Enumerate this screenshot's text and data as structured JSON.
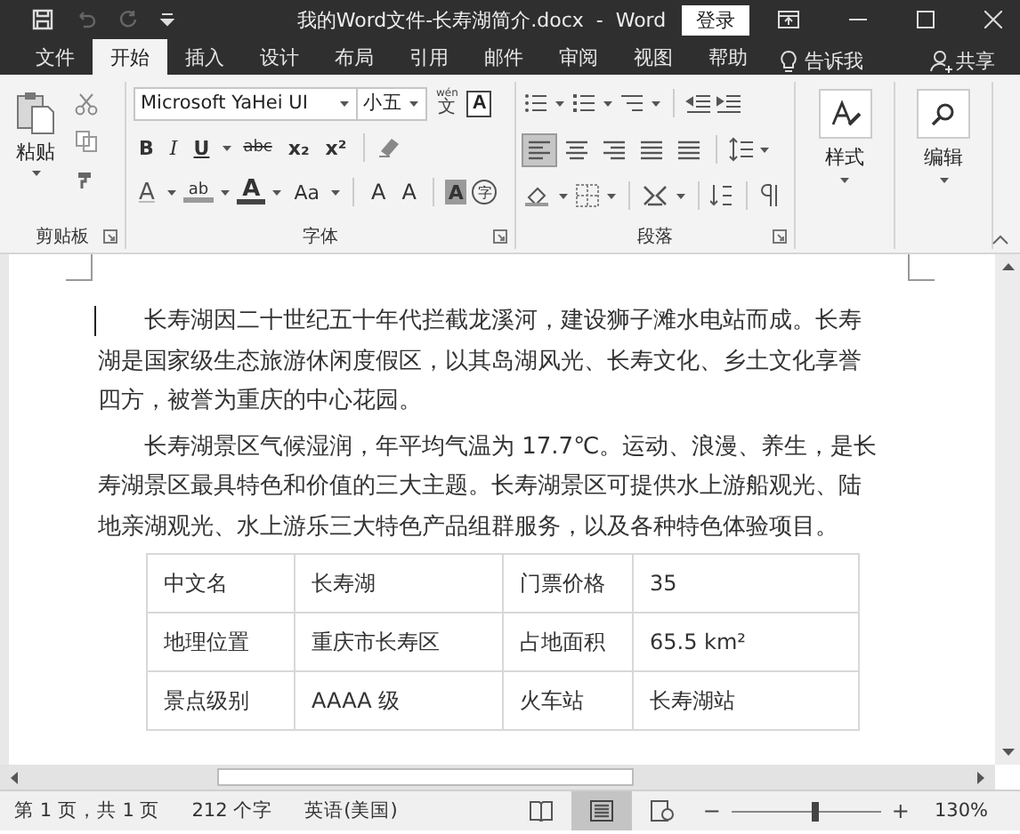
{
  "window": {
    "title": "我的Word文件-长寿湖简介.docx  -  Word",
    "sign_in": "登录"
  },
  "tabs": [
    {
      "label": "文件",
      "selected": false
    },
    {
      "label": "开始",
      "selected": true
    },
    {
      "label": "插入",
      "selected": false
    },
    {
      "label": "设计",
      "selected": false
    },
    {
      "label": "布局",
      "selected": false
    },
    {
      "label": "引用",
      "selected": false
    },
    {
      "label": "邮件",
      "selected": false
    },
    {
      "label": "审阅",
      "selected": false
    },
    {
      "label": "视图",
      "selected": false
    },
    {
      "label": "帮助",
      "selected": false
    }
  ],
  "tell_me": "告诉我",
  "share": "共享",
  "ribbon": {
    "clipboard": {
      "paste": "粘贴",
      "label": "剪贴板"
    },
    "font": {
      "font_name": "Microsoft YaHei UI",
      "font_size": "小五",
      "phonetic_top": "wén",
      "phonetic_bottom": "文",
      "border_char": "A",
      "row2": [
        {
          "label": "B",
          "kind": "bold"
        },
        {
          "label": "I",
          "kind": "italic"
        },
        {
          "label": "U",
          "kind": "underline"
        },
        {
          "label": "abc",
          "kind": "strike"
        },
        {
          "label": "x₂",
          "kind": "sub"
        },
        {
          "label": "x²",
          "kind": "sup"
        }
      ],
      "row3": [
        {
          "label": "A",
          "kind": "effects"
        },
        {
          "label": "ab",
          "kind": "highlight"
        },
        {
          "label": "A",
          "kind": "color"
        },
        {
          "label": "Aa",
          "kind": "case"
        },
        {
          "label": "A",
          "kind": "grow"
        },
        {
          "label": "A",
          "kind": "shrink"
        },
        {
          "label": "A",
          "kind": "shading"
        },
        {
          "label": "字",
          "kind": "enclose"
        }
      ],
      "label": "字体"
    },
    "paragraph": {
      "align_buttons": [
        {
          "selected": true
        },
        {
          "selected": false
        },
        {
          "selected": false
        },
        {
          "selected": false
        },
        {
          "selected": false
        }
      ],
      "label": "段落"
    },
    "styles": {
      "label": "样式"
    },
    "editing": {
      "label": "编辑"
    }
  },
  "document": {
    "paragraphs": [
      "长寿湖因二十世纪五十年代拦截龙溪河，建设狮子滩水电站而成。长寿湖是国家级生态旅游休闲度假区，以其岛湖风光、长寿文化、乡土文化享誉四方，被誉为重庆的中心花园。",
      "长寿湖景区气候湿润，年平均气温为 17.7℃。运动、浪漫、养生，是长寿湖景区最具特色和价值的三大主题。长寿湖景区可提供水上游船观光、陆地亲湖观光、水上游乐三大特色产品组群服务，以及各种特色体验项目。"
    ],
    "table": {
      "rows": [
        [
          "中文名",
          "长寿湖",
          "门票价格",
          "35"
        ],
        [
          "地理位置",
          "重庆市长寿区",
          "占地面积",
          "65.5 km²"
        ],
        [
          "景点级别",
          "AAAA 级",
          "火车站",
          "长寿湖站"
        ]
      ]
    }
  },
  "status_bar": {
    "page": "第 1 页，共 1 页",
    "words": "212 个字",
    "language": "英语(美国)",
    "view_buttons": [
      {
        "selected": false
      },
      {
        "selected": true
      },
      {
        "selected": false
      }
    ],
    "zoom_out": "−",
    "zoom_in": "+",
    "level": 0.56,
    "zoom": "130%"
  }
}
